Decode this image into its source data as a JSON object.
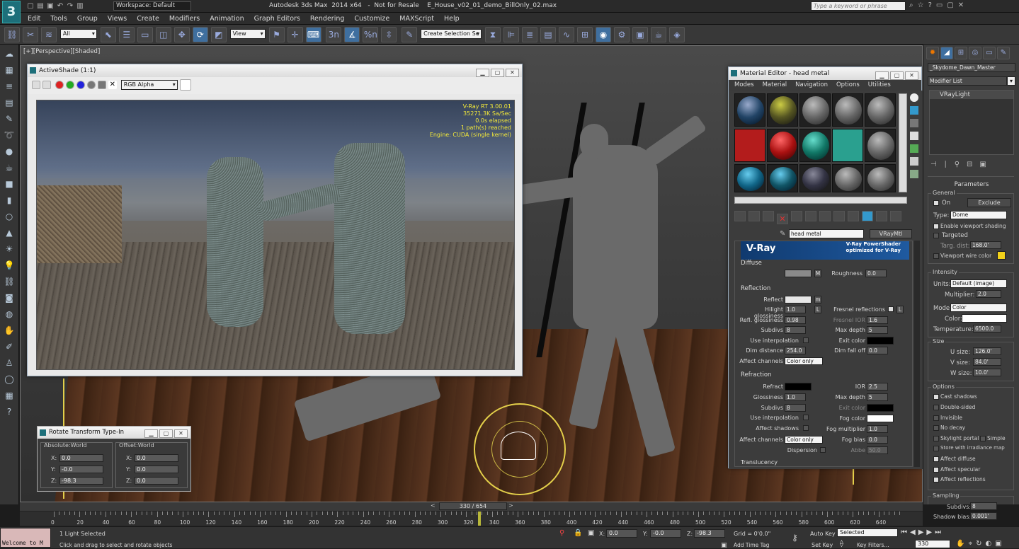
{
  "app": {
    "title": "Autodesk 3ds Max  2014 x64   -  Not for Resale    E_House_v02_01_demo_BillOnly_02.max",
    "workspace": "Workspace: Default",
    "search_placeholder": "Type a keyword or phrase",
    "logo": "3"
  },
  "menu": [
    "Edit",
    "Tools",
    "Group",
    "Views",
    "Create",
    "Modifiers",
    "Animation",
    "Graph Editors",
    "Rendering",
    "Customize",
    "MAXScript",
    "Help"
  ],
  "toolbar": {
    "selection_filter": "All",
    "ref_coord": "View",
    "named_selection": "Create Selection Se",
    "snap_label": "3n",
    "angle_snap": "%n"
  },
  "viewport": {
    "label": "[+][Perspective][Shaded]"
  },
  "activeshade": {
    "title": "ActiveShade (1:1)",
    "channel": "RGB Alpha",
    "stats": [
      "V-Ray RT 3.00.01",
      "35271.3K Sa/Sec",
      "0.0s elapsed",
      "1 path(s) reached",
      "Engine: CUDA (single kernel)"
    ]
  },
  "material_editor": {
    "title": "Material Editor - head metal",
    "menu": [
      "Modes",
      "Material",
      "Navigation",
      "Options",
      "Utilities"
    ],
    "material_name": "head metal",
    "material_type": "VRayMtl",
    "banner_main": "V-Ray",
    "banner_sub1": "V-Ray PowerShader",
    "banner_sub2": "optimized for V-Ray",
    "diffuse": {
      "header": "Diffuse",
      "diffuse_label": "Diffuse",
      "m": "M",
      "roughness_label": "Roughness",
      "roughness": "0.0"
    },
    "reflection": {
      "header": "Reflection",
      "reflect": "Reflect",
      "m": "m",
      "hilight_gloss": "Hilight glossiness",
      "hilight_gloss_val": "1.0",
      "l": "L",
      "refl_gloss": "Refl. glossiness",
      "refl_gloss_val": "0.98",
      "subdivs": "Subdivs",
      "subdivs_val": "8",
      "use_interp": "Use interpolation",
      "dim_dist": "Dim distance",
      "dim_dist_val": "254.0",
      "affect_channels": "Affect channels",
      "affect_channels_val": "Color only",
      "fresnel": "Fresnel reflections",
      "fresnel_l": "L",
      "fresnel_ior": "Fresnel IOR",
      "fresnel_ior_val": "1.6",
      "max_depth": "Max depth",
      "max_depth_val": "5",
      "exit_color": "Exit color",
      "dim_falloff": "Dim fall off",
      "dim_falloff_val": "0.0"
    },
    "refraction": {
      "header": "Refraction",
      "refract": "Refract",
      "glossiness": "Glossiness",
      "glossiness_val": "1.0",
      "subdivs": "Subdivs",
      "subdivs_val": "8",
      "use_interp": "Use interpolation",
      "affect_shadows": "Affect shadows",
      "affect_channels": "Affect channels",
      "affect_channels_val": "Color only",
      "dispersion": "Dispersion",
      "ior": "IOR",
      "ior_val": "2.5",
      "max_depth": "Max depth",
      "max_depth_val": "5",
      "exit_color": "Exit color",
      "fog_color": "Fog color",
      "fog_mult": "Fog multiplier",
      "fog_mult_val": "1.0",
      "fog_bias": "Fog bias",
      "fog_bias_val": "0.0",
      "abbe": "Abbe",
      "abbe_val": "50.0"
    },
    "translucency_header": "Translucency"
  },
  "command_panel": {
    "object_name": "_Skydome_Dawn_Master",
    "modifier_list": "Modifier List",
    "stack_item": "VRayLight",
    "parameters": "Parameters",
    "general": "General",
    "on": "On",
    "exclude": "Exclude",
    "type_label": "Type:",
    "type_val": "Dome",
    "enable_vp_shading": "Enable viewport shading",
    "targeted": "Targeted",
    "targ_dist": "Targ. dist:",
    "targ_dist_val": "168.0'",
    "vp_wire_color": "Viewport wire color",
    "intensity": "Intensity",
    "units_label": "Units:",
    "units_val": "Default (image)",
    "multiplier_label": "Multiplier:",
    "multiplier_val": "2.0",
    "mode_label": "Mode:",
    "mode_val": "Color",
    "color_label": "Color:",
    "temperature_label": "Temperature:",
    "temperature_val": "6500.0",
    "size": "Size",
    "u_size": "U size:",
    "u_size_val": "126.0'",
    "v_size": "V size:",
    "v_size_val": "84.0'",
    "w_size": "W size:",
    "w_size_val": "10.0'",
    "options": "Options",
    "opt_items": [
      "Cast shadows",
      "Double-sided",
      "Invisible",
      "No decay",
      "Skylight portal",
      "Store with irradiance map",
      "Affect diffuse",
      "Affect specular",
      "Affect reflections"
    ],
    "opt_checked": [
      true,
      false,
      false,
      false,
      false,
      false,
      true,
      true,
      true
    ],
    "simple": "Simple",
    "sampling": "Sampling",
    "subdivs_label": "Subdivs:",
    "subdivs_val": "8",
    "shadow_bias_label": "Shadow bias:",
    "shadow_bias_val": "0.001'"
  },
  "rotate_typein": {
    "title": "Rotate Transform Type-In",
    "absolute": "Absolute:World",
    "offset": "Offset:World",
    "abs": {
      "x": "0.0",
      "y": "-0.0",
      "z": "-98.3"
    },
    "off": {
      "x": "0.0",
      "y": "0.0",
      "z": "0.0"
    }
  },
  "timeline": {
    "frame": "330 / 654",
    "ticks": [
      "0",
      "20",
      "40",
      "60",
      "80",
      "100",
      "120",
      "140",
      "160",
      "180",
      "200",
      "220",
      "240",
      "260",
      "280",
      "300",
      "320",
      "340",
      "360",
      "380",
      "400",
      "420",
      "440",
      "460",
      "480",
      "500",
      "520",
      "540",
      "560",
      "580",
      "600",
      "620",
      "640"
    ]
  },
  "status": {
    "maxscript": "Welcome to M",
    "selected": "1 Light Selected",
    "prompt": "Click and drag to select and rotate objects",
    "x_label": "X:",
    "x_val": "0.0",
    "y_label": "Y:",
    "y_val": "-0.0",
    "z_label": "Z:",
    "z_val": "-98.3",
    "grid": "Grid = 0'0.0\"",
    "add_time_tag": "Add Time Tag",
    "auto_key": "Auto Key",
    "set_key": "Set Key",
    "selected_dd": "Selected",
    "key_filters": "Key Filters...",
    "frame_val": "330"
  },
  "colors": {
    "accent": "#3f6f9f",
    "viewport_bg": "#3d3d3d",
    "window_bg": "#e9e9e9",
    "stats": "#f2e83a"
  }
}
